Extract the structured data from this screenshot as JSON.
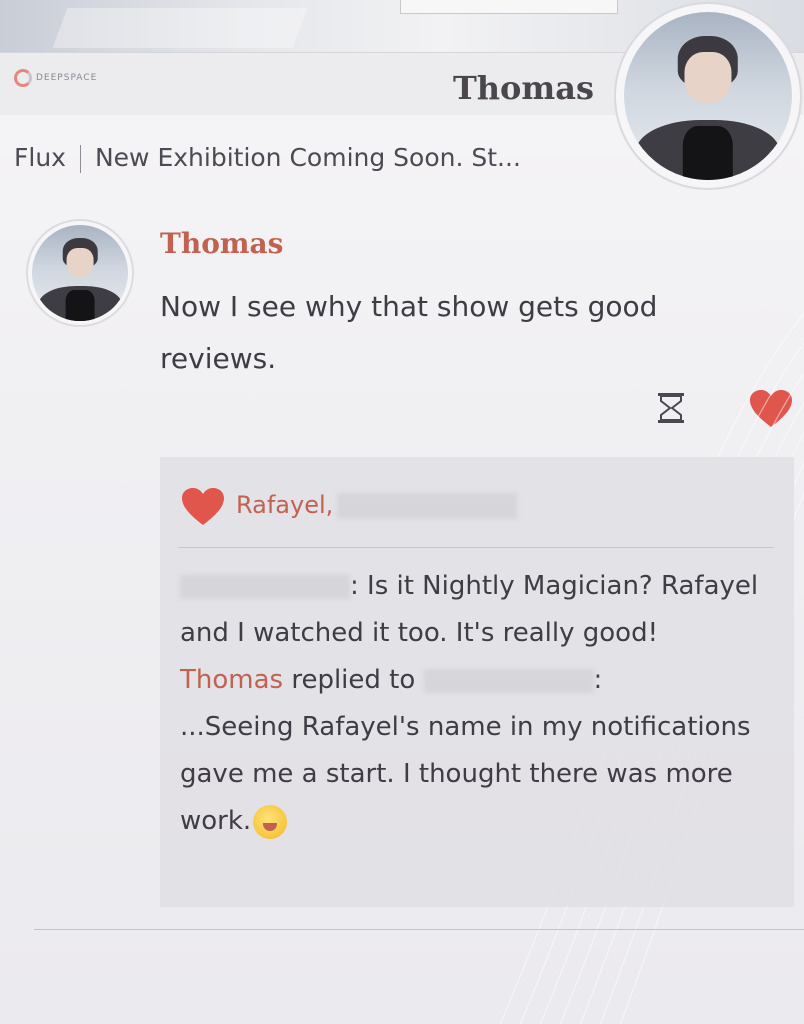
{
  "header": {
    "brand": "DEEPSPACE",
    "name": "Thomas"
  },
  "post": {
    "source": "Flux",
    "title": "New Exhibition Coming Soon. St..."
  },
  "comment": {
    "author": "Thomas",
    "text": "Now I see why that show gets good reviews."
  },
  "icons": {
    "pending": "hourglass-icon",
    "like": "heart-icon",
    "likes_marker": "heart-icon",
    "emoji": "emoji-icon"
  },
  "likes": {
    "names": "Rafayel,"
  },
  "replies": {
    "line1_suffix": ": Is it Nightly Magician? Rafayel and I watched it too. It's really good!",
    "reply_author": "Thomas",
    "reply_verb": "replied to",
    "reply_colon": ":",
    "reply_text": "...Seeing Rafayel's name in my notifications gave me a start. I thought there was more work."
  },
  "colors": {
    "accent": "#c0624f",
    "heart": "#e0564c",
    "text": "#3e3c44"
  }
}
